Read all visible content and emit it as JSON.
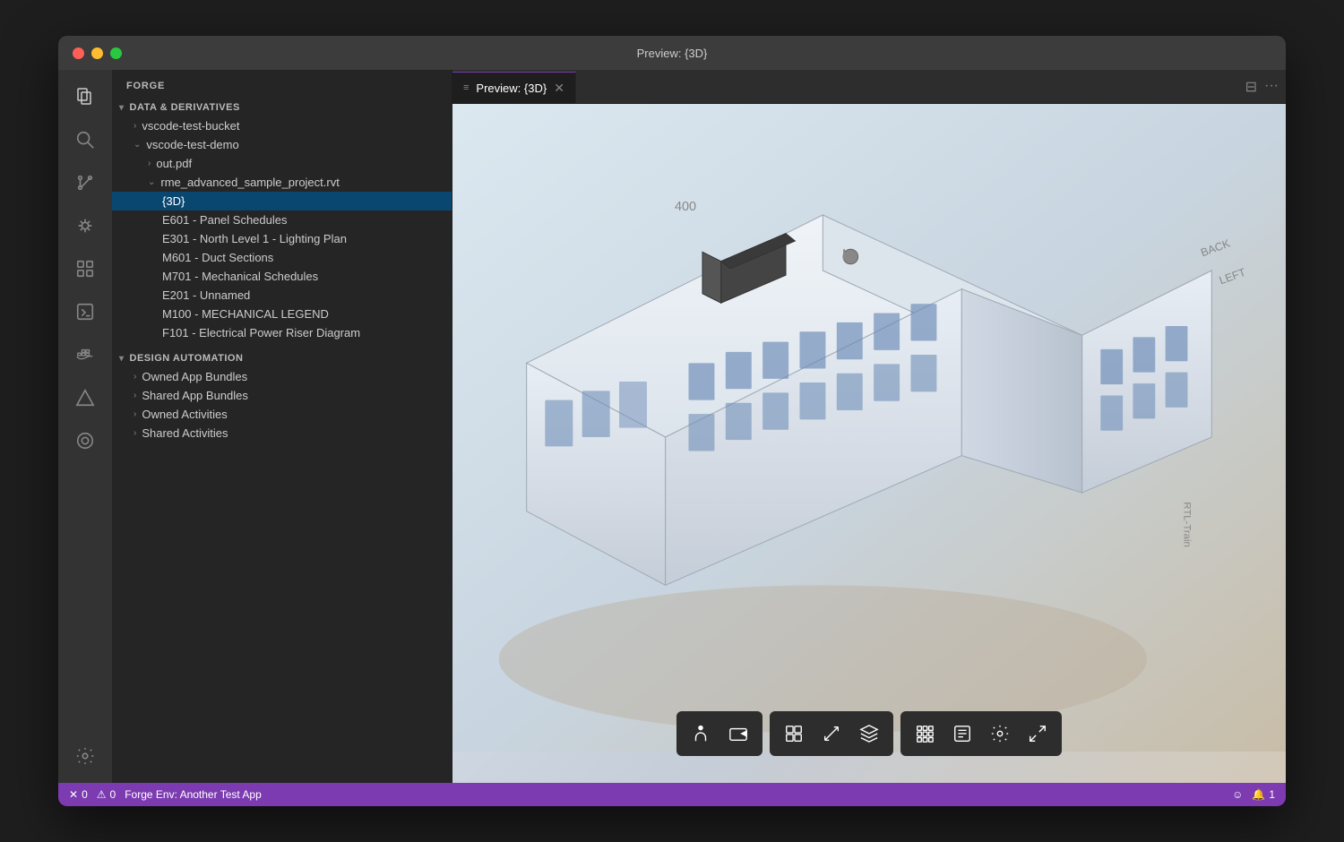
{
  "window": {
    "title": "Preview: {3D}"
  },
  "titlebar": {
    "title": "Preview: {3D}"
  },
  "activity_bar": {
    "icons": [
      {
        "name": "files-icon",
        "symbol": "⧉",
        "active": true
      },
      {
        "name": "search-icon",
        "symbol": "🔍"
      },
      {
        "name": "source-control-icon",
        "symbol": "⑂"
      },
      {
        "name": "debug-icon",
        "symbol": "🐛"
      },
      {
        "name": "extensions-icon",
        "symbol": "⊞"
      },
      {
        "name": "terminal-icon",
        "symbol": ">_"
      },
      {
        "name": "docker-icon",
        "symbol": "🐋"
      },
      {
        "name": "triangle-icon",
        "symbol": "▲"
      },
      {
        "name": "circle-icon",
        "symbol": "◎"
      }
    ],
    "bottom_icons": [
      {
        "name": "settings-icon",
        "symbol": "⚙"
      }
    ]
  },
  "sidebar": {
    "header": "FORGE",
    "sections": [
      {
        "name": "data-derivatives",
        "label": "DATA & DERIVATIVES",
        "expanded": true,
        "items": [
          {
            "label": "vscode-test-bucket",
            "indent": 1,
            "expanded": false,
            "chevron": true
          },
          {
            "label": "vscode-test-demo",
            "indent": 1,
            "expanded": true,
            "chevron": true
          },
          {
            "label": "out.pdf",
            "indent": 2,
            "expanded": false,
            "chevron": true
          },
          {
            "label": "rme_advanced_sample_project.rvt",
            "indent": 2,
            "expanded": true,
            "chevron": true
          },
          {
            "label": "{3D}",
            "indent": 3,
            "selected": true
          },
          {
            "label": "E601 - Panel Schedules",
            "indent": 3
          },
          {
            "label": "E301 - North Level 1 - Lighting Plan",
            "indent": 3
          },
          {
            "label": "M601 - Duct Sections",
            "indent": 3
          },
          {
            "label": "M701 - Mechanical Schedules",
            "indent": 3
          },
          {
            "label": "E201 - Unnamed",
            "indent": 3
          },
          {
            "label": "M100 - MECHANICAL LEGEND",
            "indent": 3
          },
          {
            "label": "F101 - Electrical Power Riser Diagram",
            "indent": 3
          }
        ]
      },
      {
        "name": "design-automation",
        "label": "DESIGN AUTOMATION",
        "expanded": true,
        "items": [
          {
            "label": "Owned App Bundles",
            "indent": 1,
            "chevron": true
          },
          {
            "label": "Shared App Bundles",
            "indent": 1,
            "chevron": true
          },
          {
            "label": "Owned Activities",
            "indent": 1,
            "chevron": true
          },
          {
            "label": "Shared Activities",
            "indent": 1,
            "chevron": true
          }
        ]
      }
    ]
  },
  "tab_bar": {
    "tabs": [
      {
        "label": "Preview: {3D}",
        "active": true,
        "icon": "≡"
      }
    ],
    "actions": [
      "⊟",
      "···"
    ]
  },
  "viewer": {
    "toolbar_groups": [
      {
        "buttons": [
          {
            "name": "person-icon",
            "symbol": "🚶"
          },
          {
            "name": "camera-icon",
            "symbol": "📷"
          }
        ]
      },
      {
        "buttons": [
          {
            "name": "explode-icon",
            "symbol": "⊡"
          },
          {
            "name": "measure-icon",
            "symbol": "📏"
          },
          {
            "name": "model-icon",
            "symbol": "⬡"
          }
        ]
      },
      {
        "buttons": [
          {
            "name": "structure-icon",
            "symbol": "⊞"
          },
          {
            "name": "properties-icon",
            "symbol": "☰"
          },
          {
            "name": "settings-viewer-icon",
            "symbol": "⚙"
          },
          {
            "name": "fullscreen-icon",
            "symbol": "⤢"
          }
        ]
      }
    ]
  },
  "status_bar": {
    "env_label": "Forge Env: Another Test App",
    "errors": "0",
    "warnings": "0",
    "notifications": "1",
    "error_icon": "✕",
    "warning_icon": "⚠",
    "face_icon": "☺",
    "bell_icon": "🔔"
  }
}
